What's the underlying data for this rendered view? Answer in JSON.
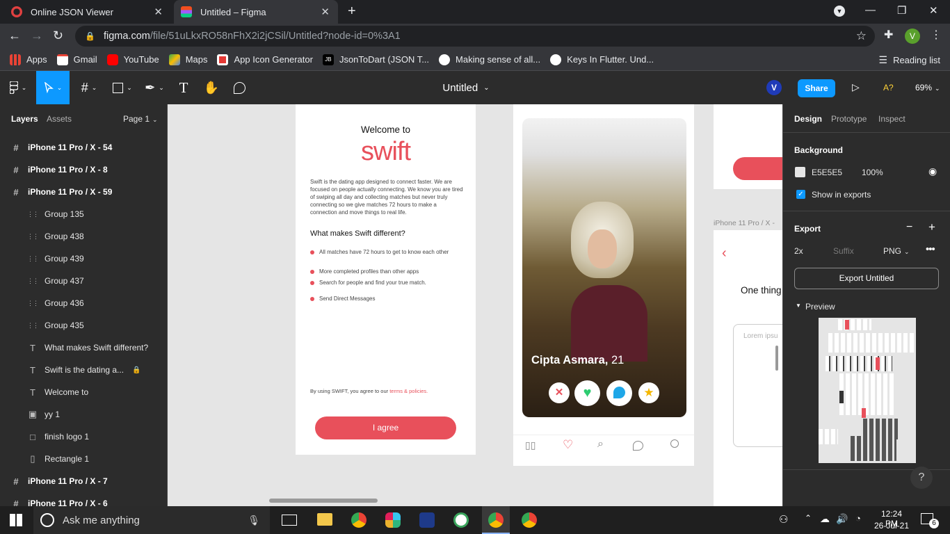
{
  "browser": {
    "tabs": [
      {
        "title": "Online JSON Viewer",
        "active": false
      },
      {
        "title": "Untitled – Figma",
        "active": true
      }
    ],
    "url_host": "figma.com",
    "url_path": "/file/51uLkxRO58nFhX2i2jCSil/Untitled?node-id=0%3A1",
    "profile_initial": "V",
    "bookmarks": [
      "Apps",
      "Gmail",
      "YouTube",
      "Maps",
      "App Icon Generator",
      "JsonToDart (JSON T...",
      "Making sense of all...",
      "Keys In Flutter. Und..."
    ],
    "reading_list": "Reading list"
  },
  "figma": {
    "file_title": "Untitled",
    "user_initial": "V",
    "share_label": "Share",
    "a_label": "A?",
    "zoom": "69%",
    "left_panel": {
      "tab_layers": "Layers",
      "tab_assets": "Assets",
      "page": "Page 1",
      "layers": [
        {
          "name": "iPhone 11 Pro / X - 54",
          "type": "frame",
          "indent": 0
        },
        {
          "name": "iPhone 11 Pro / X - 8",
          "type": "frame",
          "indent": 0
        },
        {
          "name": "iPhone 11 Pro / X - 59",
          "type": "frame",
          "indent": 0
        },
        {
          "name": "Group 135",
          "type": "group",
          "indent": 1
        },
        {
          "name": "Group 438",
          "type": "group",
          "indent": 1
        },
        {
          "name": "Group 439",
          "type": "group",
          "indent": 1
        },
        {
          "name": "Group 437",
          "type": "group",
          "indent": 1
        },
        {
          "name": "Group 436",
          "type": "group",
          "indent": 1
        },
        {
          "name": "Group 435",
          "type": "group",
          "indent": 1
        },
        {
          "name": "What makes Swift different?",
          "type": "text",
          "indent": 1
        },
        {
          "name": "Swift is the dating a...",
          "type": "text",
          "indent": 1,
          "locked": true
        },
        {
          "name": "Welcome to",
          "type": "text",
          "indent": 1
        },
        {
          "name": "yy 1",
          "type": "image",
          "indent": 1
        },
        {
          "name": "finish logo 1",
          "type": "rect",
          "indent": 1
        },
        {
          "name": "Rectangle 1",
          "type": "rect-thin",
          "indent": 1
        },
        {
          "name": "iPhone 11 Pro / X - 7",
          "type": "frame",
          "indent": 0
        },
        {
          "name": "iPhone 11 Pro / X - 6",
          "type": "frame",
          "indent": 0
        }
      ]
    },
    "canvas": {
      "welcome_frame": {
        "welcome": "Welcome to",
        "logo": "swift",
        "intro": "Swift is the dating app designed to connect faster. We are focused on people actually connecting. We know you are tired of swiping all day and collecting matches but never truly connecting so we give matches 72 hours to make a connection and move things to real life.",
        "heading": "What makes Swift different?",
        "bullets": [
          "All matches have 72 hours to get to know each other",
          "More completed profiles than other apps",
          "Search for people and find your true match.",
          "Send Direct Messages"
        ],
        "terms_prefix": "By using SWIFT, you agree to our ",
        "terms_link": "terms & policies.",
        "agree_button": "I agree"
      },
      "profile_frame": {
        "name": "Cipta Asmara,",
        "age": "21"
      },
      "side_frame": {
        "label": "iPhone 11 Pro / X -",
        "heading": "One thing",
        "placeholder": "Lorem ipsu"
      }
    },
    "right_panel": {
      "tabs": [
        "Design",
        "Prototype",
        "Inspect"
      ],
      "background_label": "Background",
      "bg_hex": "E5E5E5",
      "bg_opacity": "100%",
      "show_in_exports": "Show in exports",
      "export_label": "Export",
      "export_scale": "2x",
      "export_suffix": "Suffix",
      "export_format": "PNG",
      "export_button": "Export Untitled",
      "preview_label": "Preview",
      "help": "?"
    }
  },
  "taskbar": {
    "search_placeholder": "Ask me anything",
    "time": "12:24 PM",
    "date": "26-Jul-21",
    "notification_count": "6"
  },
  "colors": {
    "accent_red": "#e8505b",
    "figma_blue": "#0d99ff",
    "panel": "#2c2c2c",
    "canvas_bg": "#e5e5e5"
  }
}
